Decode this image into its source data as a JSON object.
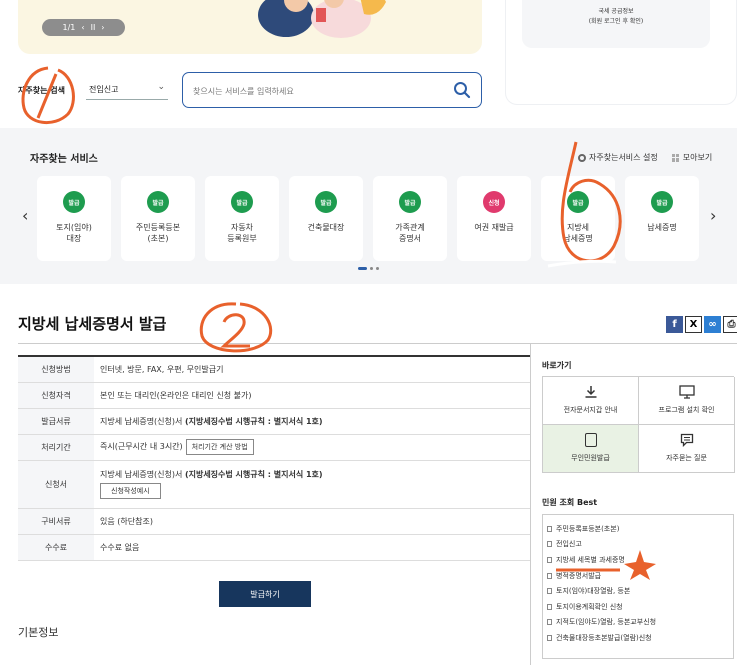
{
  "banner": {
    "pager": {
      "current": "1/1",
      "prev": "‹",
      "pause": "II",
      "next": "›"
    }
  },
  "login_box": {
    "line1": "국세 공급정보",
    "line2": "(회원 로그인 후 확인)"
  },
  "search": {
    "freq_label": "자주찾는 검색",
    "select_value": "전입신고",
    "placeholder": "찾으시는 서비스를 입력하세요"
  },
  "frequent": {
    "title": "자주찾는 서비스",
    "settings_label": "자주찾는서비스 설정",
    "collect_label": "모아보기",
    "cards": [
      {
        "badge": "발급",
        "name": "토지(임야)\n대장",
        "kind": "issue"
      },
      {
        "badge": "발급",
        "name": "주민등록등본\n(초본)",
        "kind": "issue"
      },
      {
        "badge": "발급",
        "name": "자동차\n등록원부",
        "kind": "issue"
      },
      {
        "badge": "발급",
        "name": "건축물대장",
        "kind": "issue"
      },
      {
        "badge": "발급",
        "name": "가족관계\n증명서",
        "kind": "issue"
      },
      {
        "badge": "신청",
        "name": "여권 재발급",
        "kind": "apply"
      },
      {
        "badge": "발급",
        "name": "지방세\n납세증명",
        "kind": "issue"
      },
      {
        "badge": "발급",
        "name": "납세증명",
        "kind": "issue"
      }
    ]
  },
  "page": {
    "title": "지방세 납세증명서 발급",
    "share": {
      "facebook": "f",
      "x": "X",
      "link": "∞",
      "print": "⎙"
    }
  },
  "info": {
    "rows": [
      {
        "key": "신청방법",
        "value": "인터넷, 방문, FAX, 우편, 무인발급기"
      },
      {
        "key": "신청자격",
        "value": "본인 또는 대리인(온라인은 대리인 신청 불가)"
      },
      {
        "key": "발급서류",
        "value_prefix": "지방세 납세증명(신청)서 ",
        "value_bold": "(지방세징수법 시행규칙 : 별지서식 1호)"
      },
      {
        "key": "처리기간",
        "value": "즉시(근무시간 내 3시간)",
        "button": "처리기간 계산 방법"
      },
      {
        "key": "신청서",
        "value_prefix": "지방세 납세증명(신청)서 ",
        "value_bold": "(지방세징수법 시행규칙 : 별지서식 1호)",
        "button": "신청작성예시"
      },
      {
        "key": "구비서류",
        "value": "있음 (하단참조)"
      },
      {
        "key": "수수료",
        "value": "수수료 없음"
      }
    ],
    "issue_button": "발급하기",
    "basic_info": "기본정보"
  },
  "sidebar": {
    "quick_title": "바로가기",
    "quick_items": [
      {
        "label": "전자문서지갑 안내",
        "icon": "download-icon"
      },
      {
        "label": "프로그램 설치 확인",
        "icon": "monitor-icon"
      },
      {
        "label": "무인민원발급",
        "icon": "kiosk-icon"
      },
      {
        "label": "자주묻는 질문",
        "icon": "chat-icon"
      }
    ],
    "best_title": "민원 조회 Best",
    "best_items": [
      "주민등록표등본(초본)",
      "전입신고",
      "지방세 세목별 과세증명",
      "병적증명서발급",
      "토지(임야)대장열람, 등본",
      "토지이용계획확인 신청",
      "지적도(임야도)열람, 등본교부신청",
      "건축물대장등초본발급(열람)신청"
    ]
  },
  "annotations": {
    "circle1": "1",
    "circle2": "2",
    "circle3": "3"
  },
  "colors": {
    "primary": "#2d5fa8",
    "issue_badge": "#1e9c4f",
    "apply_badge": "#e03a6d",
    "issue_button": "#17365d",
    "annotation": "#e8612c"
  }
}
